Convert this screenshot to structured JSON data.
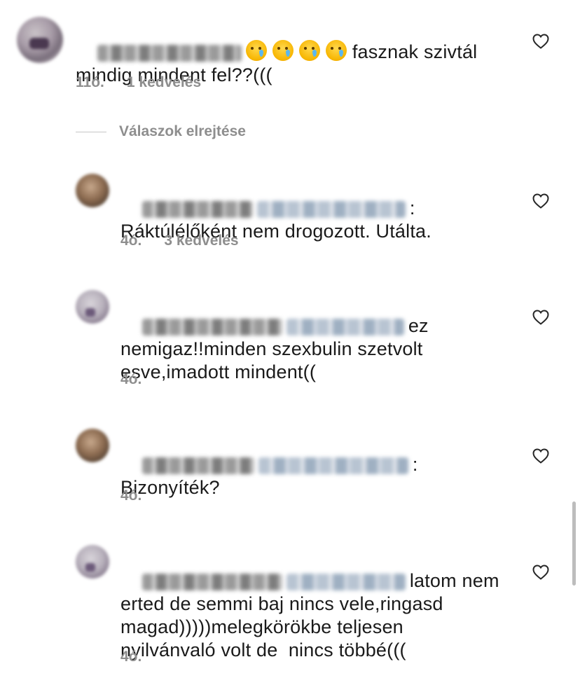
{
  "main_comment": {
    "text_line1": "fasznak szivtál",
    "text_line2": "mindig mindent fel??(((",
    "emoji_count": 4,
    "time": "11ó.",
    "likes": "1 kedvelés"
  },
  "hide_replies_label": "Válaszok elrejtése",
  "replies": [
    {
      "lines": [
        "Ráktúlélőként nem drogozott. Utálta."
      ],
      "suffix": ":",
      "time": "4ó.",
      "likes": "3 kedvelés"
    },
    {
      "suffix": "ez",
      "lines": [
        "nemigaz!!minden szexbulin szetvolt",
        "esve,imadott mindent(("
      ],
      "time": "4ó."
    },
    {
      "suffix": ":",
      "lines": [
        "Bizonyíték?"
      ],
      "time": "4ó."
    },
    {
      "suffix": "latom nem",
      "lines": [
        "erted de semmi baj nincs vele,ringasd",
        "magad)))))melegkörökbe teljesen",
        "nyilvánvaló volt de  nincs többé((("
      ],
      "time": "4ó."
    }
  ],
  "icons": {
    "like": "heart-outline-icon"
  },
  "colors": {
    "meta": "#8e8e8e",
    "text": "#1a1a1a"
  }
}
